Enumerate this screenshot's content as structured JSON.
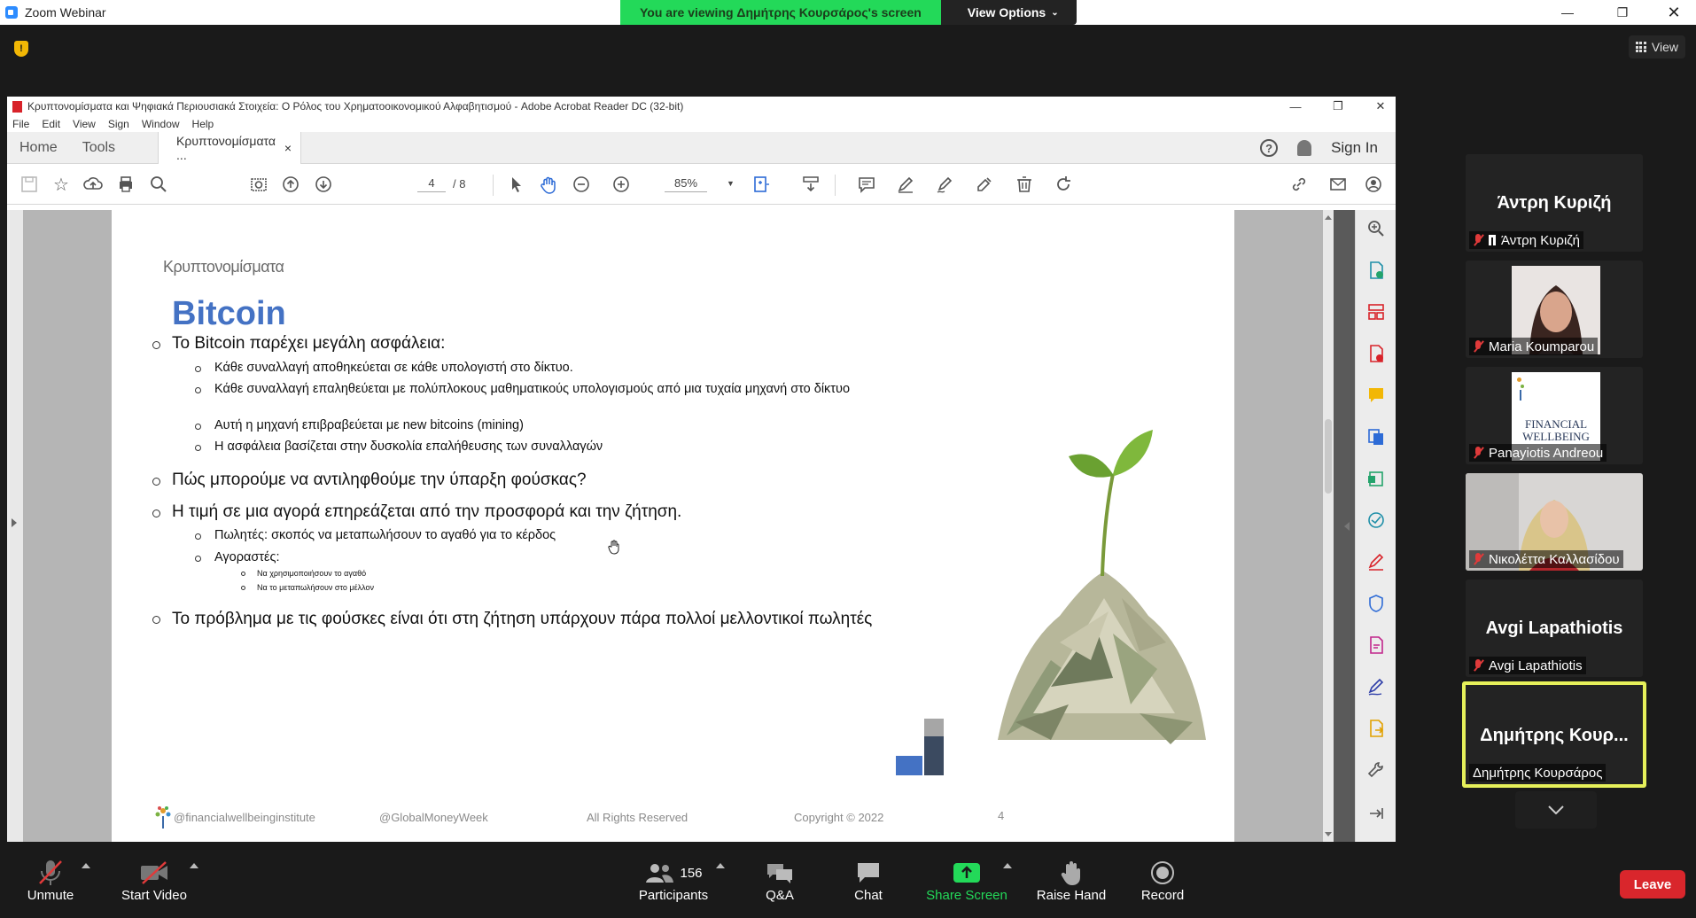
{
  "zoom": {
    "title": "Zoom Webinar",
    "viewing_banner": "You are viewing Δημήτρης Κουρσάρος's screen",
    "view_options": "View Options",
    "view_label": "View",
    "leave": "Leave",
    "controls": {
      "unmute": "Unmute",
      "start_video": "Start Video",
      "participants_count": "156",
      "participants": "Participants",
      "qa": "Q&A",
      "chat": "Chat",
      "share_screen": "Share Screen",
      "raise_hand": "Raise Hand",
      "record": "Record"
    },
    "participants": [
      {
        "big": "Άντρη Κυριζή",
        "name": "Άντρη Κυριζή"
      },
      {
        "name": "Maria Koumparou"
      },
      {
        "name": "Panayiotis Andreou",
        "logo_text": "FINANCIAL WELLBEING"
      },
      {
        "name": "Νικολέττα Καλλασίδου"
      },
      {
        "big": "Avgi Lapathiotis",
        "name": "Avgi Lapathiotis"
      },
      {
        "big": "Δημήτρης Κουρ...",
        "name": "Δημήτρης Κουρσάρος"
      }
    ]
  },
  "acrobat": {
    "title": "Κρυπτονομίσματα και Ψηφιακά Περιουσιακά Στοιχεία: Ο Ρόλος του Χρηματοοικονομικού Αλφαβητισμού - Adobe Acrobat Reader DC (32-bit)",
    "menu": [
      "File",
      "Edit",
      "View",
      "Sign",
      "Window",
      "Help"
    ],
    "tabs": {
      "home": "Home",
      "tools": "Tools",
      "doc": "Κρυπτονομίσματα ...",
      "close": "×"
    },
    "sign_in": "Sign In",
    "help": "?",
    "page_current": "4",
    "page_total": "/ 8",
    "zoom": "85%"
  },
  "slide": {
    "kicker": "Κρυπτονομίσματα",
    "title": "Bitcoin",
    "bullets": [
      {
        "level": 1,
        "text": "Το Bitcoin παρέχει μεγάλη ασφάλεια:"
      },
      {
        "level": 2,
        "text": "Κάθε συναλλαγή αποθηκεύεται σε κάθε υπολογιστή στο δίκτυο."
      },
      {
        "level": 2,
        "text": "Κάθε συναλλαγή επαληθεύεται με πολύπλοκους μαθηματικούς υπολογισμούς από μια τυχαία μηχανή στο δίκτυο"
      },
      {
        "level": 2,
        "text": "Αυτή η μηχανή επιβραβεύεται με new bitcoins (mining)"
      },
      {
        "level": 2,
        "text": "Η ασφάλεια βασίζεται στην δυσκολία επαλήθευσης των συναλλαγών"
      },
      {
        "level": 1,
        "text": "Πώς μπορούμε να αντιληφθούμε την ύπαρξη φούσκας?"
      },
      {
        "level": 1,
        "text": "Η τιμή σε μια αγορά επηρεάζεται από την προσφορά και την ζήτηση."
      },
      {
        "level": 2,
        "text": "Πωλητές: σκοπός να μεταπωλήσουν το αγαθό για το κέρδος"
      },
      {
        "level": 2,
        "text": "Αγοραστές:"
      },
      {
        "level": 3,
        "text": "Να χρησιμοποιήσουν το αγαθό"
      },
      {
        "level": 3,
        "text": "Να το μεταπωλήσουν στο μέλλον"
      },
      {
        "level": 1,
        "text": "Το πρόβλημα με τις φούσκες είναι ότι στη ζήτηση υπάρχουν πάρα πολλοί μελλοντικοί πωλητές"
      }
    ],
    "footer": {
      "instagram": "@financialwellbeinginstitute",
      "gmw": "@GlobalMoneyWeek",
      "rights": "All Rights Reserved",
      "copyright": "Copyright © 2022",
      "page": "4"
    }
  },
  "colors": {
    "accent_blue": "#4472c4",
    "zoom_green": "#23d959",
    "leave_red": "#d9262c",
    "active_tile": "#e6f05a"
  }
}
